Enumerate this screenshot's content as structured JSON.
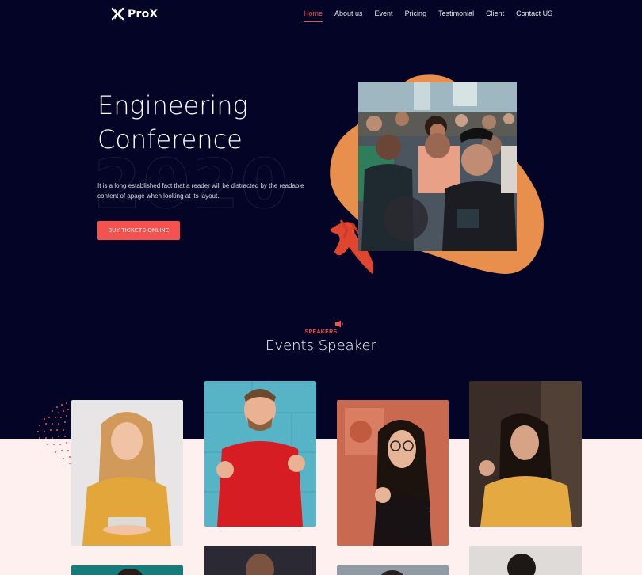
{
  "brand": {
    "name": "ProX",
    "logo_icon": "x-logo-icon"
  },
  "nav": {
    "items": [
      {
        "label": "Home",
        "active": true
      },
      {
        "label": "About us",
        "active": false
      },
      {
        "label": "Event",
        "active": false
      },
      {
        "label": "Pricing",
        "active": false
      },
      {
        "label": "Testimonial",
        "active": false
      },
      {
        "label": "Client",
        "active": false
      },
      {
        "label": "Contact US",
        "active": false
      }
    ]
  },
  "hero": {
    "title_line1": "Engineering",
    "title_line2": "Conference",
    "year": "2020",
    "description": "It is a long established fact that a reader will be distracted by the readable content of apage when looking at its layout.",
    "cta_label": "BUY TICKETS ONLINE"
  },
  "speakers": {
    "eyebrow": "SPEAKERS",
    "title": "Events Speaker",
    "icon": "megaphone-icon"
  },
  "colors": {
    "background": "#040526",
    "accent": "#f5524f",
    "blob": "#e88f4e",
    "lower_bg": "#fdf0ef"
  }
}
